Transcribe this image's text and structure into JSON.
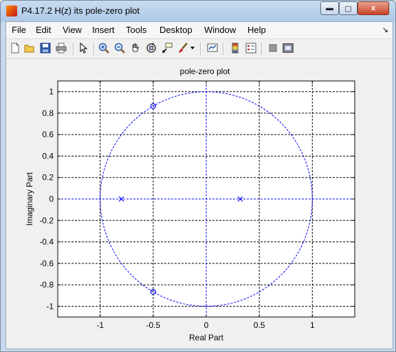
{
  "window": {
    "title": "P4.17.2 H(z) its pole-zero plot",
    "close_glyph": "x",
    "min_glyph": "▬",
    "max_glyph": "▢"
  },
  "menu": [
    "File",
    "Edit",
    "View",
    "Insert",
    "Tools",
    "Desktop",
    "Window",
    "Help"
  ],
  "dock_glyph": "↘",
  "toolbar_icons": [
    "new-figure-icon",
    "open-file-icon",
    "save-icon",
    "print-icon",
    "select-arrow-icon",
    "zoom-in-icon",
    "zoom-out-icon",
    "pan-hand-icon",
    "rotate-3d-icon",
    "data-cursor-icon",
    "brush-icon",
    "brush-dropdown-icon",
    "link-plot-icon",
    "insert-colorbar-icon",
    "insert-legend-icon",
    "hide-plot-tools-icon",
    "show-plot-tools-icon"
  ],
  "colors": {
    "plot": "#0000ff",
    "grid": "#000000",
    "figure_bg": "#f0f0f0"
  },
  "chart_data": {
    "type": "scatter",
    "title": "pole-zero plot",
    "xlabel": "Real Part",
    "ylabel": "Imaginary Part",
    "xlim": [
      -1.4,
      1.4
    ],
    "ylim": [
      -1.1,
      1.1
    ],
    "xticks": [
      -1,
      -0.5,
      0,
      0.5,
      1
    ],
    "xtick_labels": [
      "-1",
      "-0.5",
      "0",
      "0.5",
      "1"
    ],
    "yticks": [
      1,
      0.8,
      0.6,
      0.4,
      0.2,
      0,
      -0.2,
      -0.4,
      -0.6,
      -0.8,
      -1
    ],
    "ytick_labels": [
      "1",
      "0.8",
      "0.6",
      "0.4",
      "0.2",
      "0",
      "-0.2",
      "-0.4",
      "-0.6",
      "-0.8",
      "-1"
    ],
    "grid": true,
    "unit_circle": true,
    "zeros": [
      {
        "re": -0.5,
        "im": 0.866
      },
      {
        "re": -0.5,
        "im": -0.866
      }
    ],
    "poles": [
      {
        "re": -0.8,
        "im": 0
      },
      {
        "re": 0.32,
        "im": 0
      }
    ]
  }
}
